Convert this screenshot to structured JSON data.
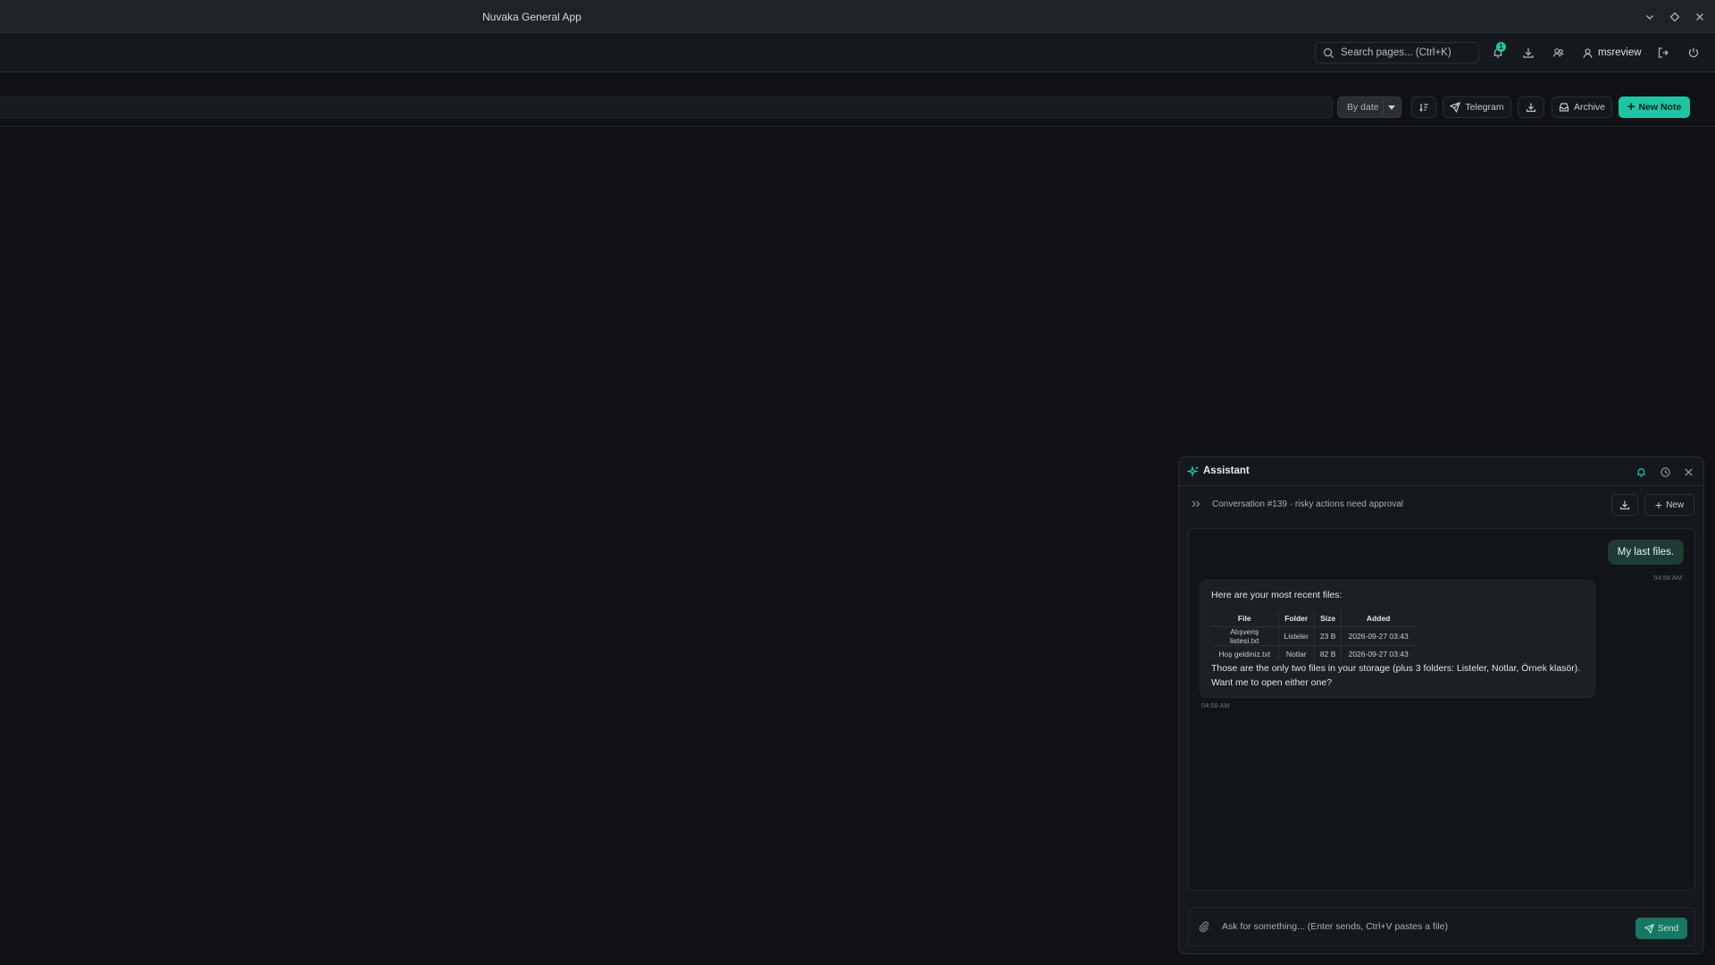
{
  "window": {
    "title": "Nuvaka General App"
  },
  "header": {
    "search_placeholder": "Search pages... (Ctrl+K)",
    "notification_count": "1",
    "username": "msreview"
  },
  "toolbar": {
    "sort_label": "By date",
    "telegram_label": "Telegram",
    "archive_label": "Archive",
    "new_note_label": "New Note"
  },
  "assistant": {
    "title": "Assistant",
    "conversation": "Conversation #139 · risky actions need approval",
    "new_label": "New",
    "messages": {
      "user_text": "My last files.",
      "user_time": "04:58 AM",
      "bot_intro": "Here are your most recent files:",
      "bot_outro": "Those are the only two files in your storage (plus 3 folders: Listeler, Notlar, Örnek klasör). Want me to open either one?",
      "bot_time": "04:58 AM"
    },
    "table": {
      "headers": [
        "File",
        "Folder",
        "Size",
        "Added"
      ],
      "rows": [
        [
          "Alışveriş listesi.txt",
          "Listeler",
          "23 B",
          "2026-09-27 03:43"
        ],
        [
          "Hoş geldiniz.txt",
          "Notlar",
          "82 B",
          "2026-09-27 03:43"
        ]
      ]
    },
    "composer_placeholder": "Ask for something... (Enter sends, Ctrl+V pastes a file)",
    "send_label": "Send"
  },
  "colors": {
    "accent": "#1fc4a4",
    "background": "#0f1115",
    "panel": "#15181c",
    "user_bubble": "#1f3b35"
  },
  "icons": [
    "chevron-down-icon",
    "restore-icon",
    "close-icon",
    "search-icon",
    "bell-icon",
    "download-icon",
    "users-icon",
    "user-icon",
    "logout-icon",
    "power-icon",
    "sort-icon",
    "send-icon",
    "archive-icon",
    "plus-icon",
    "sparkle-icon",
    "history-icon",
    "expand-icon",
    "paperclip-icon"
  ]
}
